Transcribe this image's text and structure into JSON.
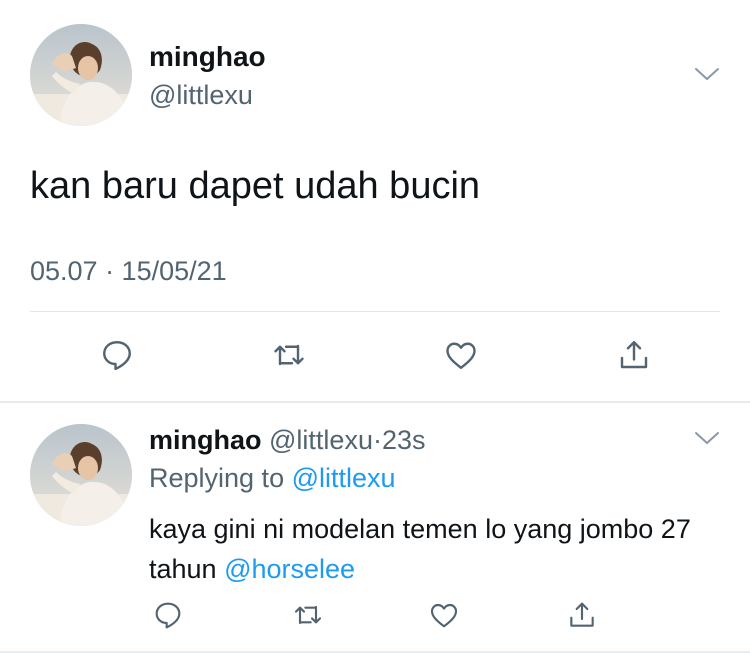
{
  "main_tweet": {
    "display_name": "minghao",
    "handle": "@littlexu",
    "text": "kan baru dapet udah bucin",
    "timestamp": "05.07 · 15/05/21",
    "actions": [
      "reply-icon",
      "retweet-icon",
      "like-icon",
      "share-icon"
    ]
  },
  "reply_tweet": {
    "display_name": "minghao",
    "handle": "@littlexu",
    "separator": "·",
    "time": "23s",
    "replying_prefix": "Replying to",
    "replying_to": "@littlexu",
    "text_part1": "kaya gini ni modelan temen lo yang jombo 27 tahun",
    "mention": "@horselee",
    "actions": [
      "reply-icon",
      "retweet-icon",
      "like-icon",
      "share-icon"
    ]
  },
  "colors": {
    "text": "#0f1419",
    "secondary": "#536471",
    "link": "#1d9bf0",
    "divider": "#e6ecf0"
  }
}
